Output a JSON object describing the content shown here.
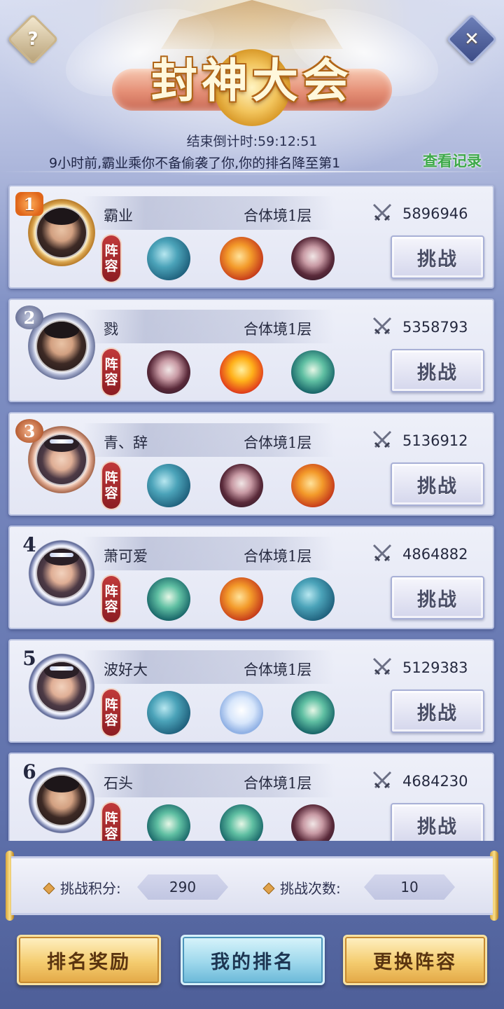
{
  "header": {
    "title": "封神大会",
    "countdown_label": "结束倒计时:",
    "countdown_value": "59:12:51",
    "news": "9小时前,霸业乘你不备偷袭了你,你的排名降至第1",
    "record_link": "查看记录",
    "help_icon": "question-icon",
    "close_icon": "close-icon"
  },
  "lineup_label_1": "阵",
  "lineup_label_2": "容",
  "challenge_label": "挑战",
  "ranks": [
    {
      "rank": "1",
      "name": "霸业",
      "realm": "合体境1层",
      "power": "5896946",
      "pets": [
        "whale",
        "fire-dragon",
        "dark-dragon"
      ]
    },
    {
      "rank": "2",
      "name": "戮",
      "realm": "合体境1层",
      "power": "5358793",
      "pets": [
        "dark-dragon",
        "phoenix",
        "green-dragon"
      ]
    },
    {
      "rank": "3",
      "name": "青、辞",
      "realm": "合体境1层",
      "power": "5136912",
      "pets": [
        "whale",
        "dark-dragon",
        "fire-dragon"
      ]
    },
    {
      "rank": "4",
      "name": "萧可爱",
      "realm": "合体境1层",
      "power": "4864882",
      "pets": [
        "green-dragon",
        "fire-dragon",
        "whale"
      ]
    },
    {
      "rank": "5",
      "name": "波好大",
      "realm": "合体境1层",
      "power": "5129383",
      "pets": [
        "whale",
        "white-dragon",
        "green-dragon"
      ]
    },
    {
      "rank": "6",
      "name": "石头",
      "realm": "合体境1层",
      "power": "4684230",
      "pets": [
        "green-dragon",
        "green-dragon",
        "dark-dragon"
      ]
    }
  ],
  "stats": {
    "score_label": "挑战积分:",
    "score_value": "290",
    "count_label": "挑战次数:",
    "count_value": "10"
  },
  "actions": {
    "rank_reward": "排名奖励",
    "my_rank": "我的排名",
    "change_lineup": "更换阵容"
  }
}
